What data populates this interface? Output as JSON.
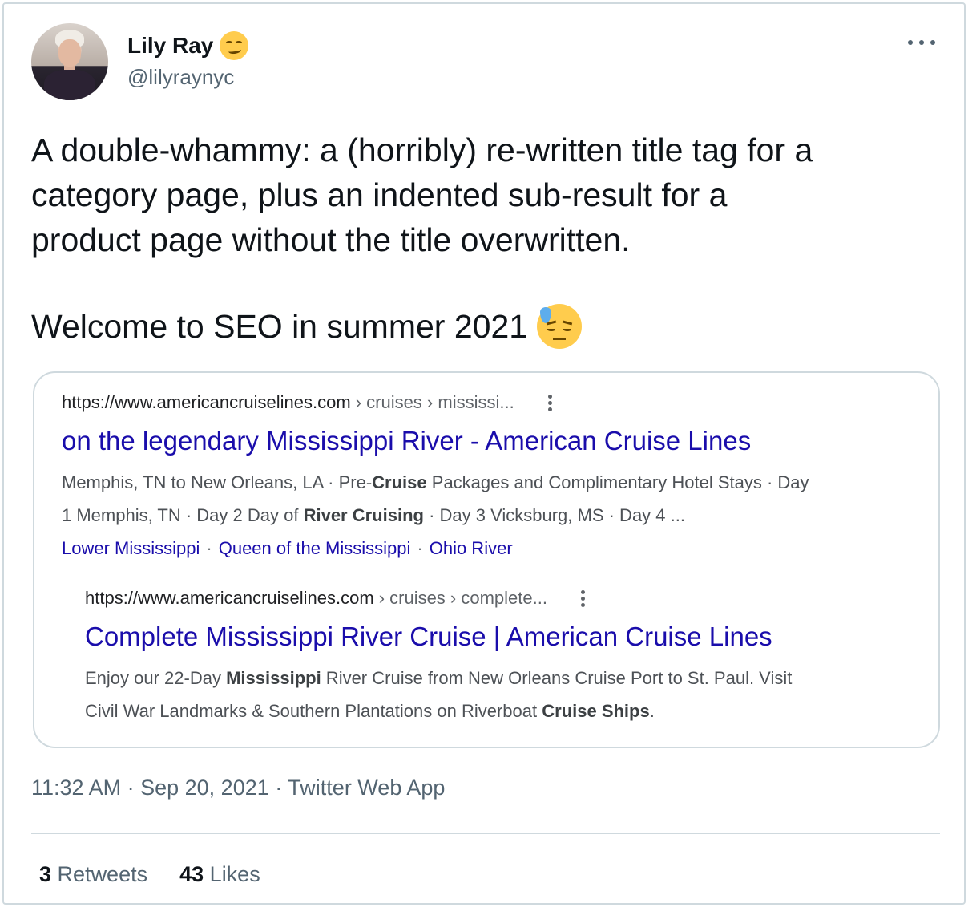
{
  "author": {
    "name": "Lily Ray",
    "handle": "@lilyraynyc",
    "name_emoji": "smirking-face-icon"
  },
  "tweet": {
    "text": "A double-whammy: a (horribly) re-written title tag for a\ncategory page, plus an indented sub-result for a\nproduct page without the title overwritten.",
    "text2": "Welcome to SEO in summer 2021",
    "emoji": "downcast-face-with-sweat-icon",
    "time": "11:32 AM",
    "date": "Sep 20, 2021",
    "source": "Twitter Web App",
    "sep": "·"
  },
  "serp": {
    "result1": {
      "domain": "https://www.americancruiselines.com",
      "path": "› cruises › mississi...",
      "title": "on the legendary Mississippi River - American Cruise Lines",
      "snippet_line1_a": "Memphis, TN to New Orleans, LA · Pre-",
      "snippet_line1_b": "Cruise",
      "snippet_line1_c": " Packages and Complimentary Hotel Stays · Day",
      "snippet_line2_a": "1 Memphis, TN · Day 2 Day of ",
      "snippet_line2_b": "River Cruising",
      "snippet_line2_c": " · Day 3 Vicksburg, MS · Day 4 ...",
      "sitelinks": [
        "Lower Mississippi",
        "Queen of the Mississippi",
        "Ohio River"
      ]
    },
    "result2": {
      "domain": "https://www.americancruiselines.com",
      "path": "› cruises › complete...",
      "title": "Complete Mississippi River Cruise | American Cruise Lines",
      "snippet_line1_a": "Enjoy our 22-Day ",
      "snippet_line1_b": "Mississippi",
      "snippet_line1_c": " River Cruise from New Orleans Cruise Port to St. Paul. Visit",
      "snippet_line2_a": "Civil War Landmarks & Southern Plantations on Riverboat ",
      "snippet_line2_b": "Cruise Ships",
      "snippet_line2_c": "."
    }
  },
  "stats": {
    "retweets_count": "3",
    "retweets_label": "Retweets",
    "likes_count": "43",
    "likes_label": "Likes"
  }
}
